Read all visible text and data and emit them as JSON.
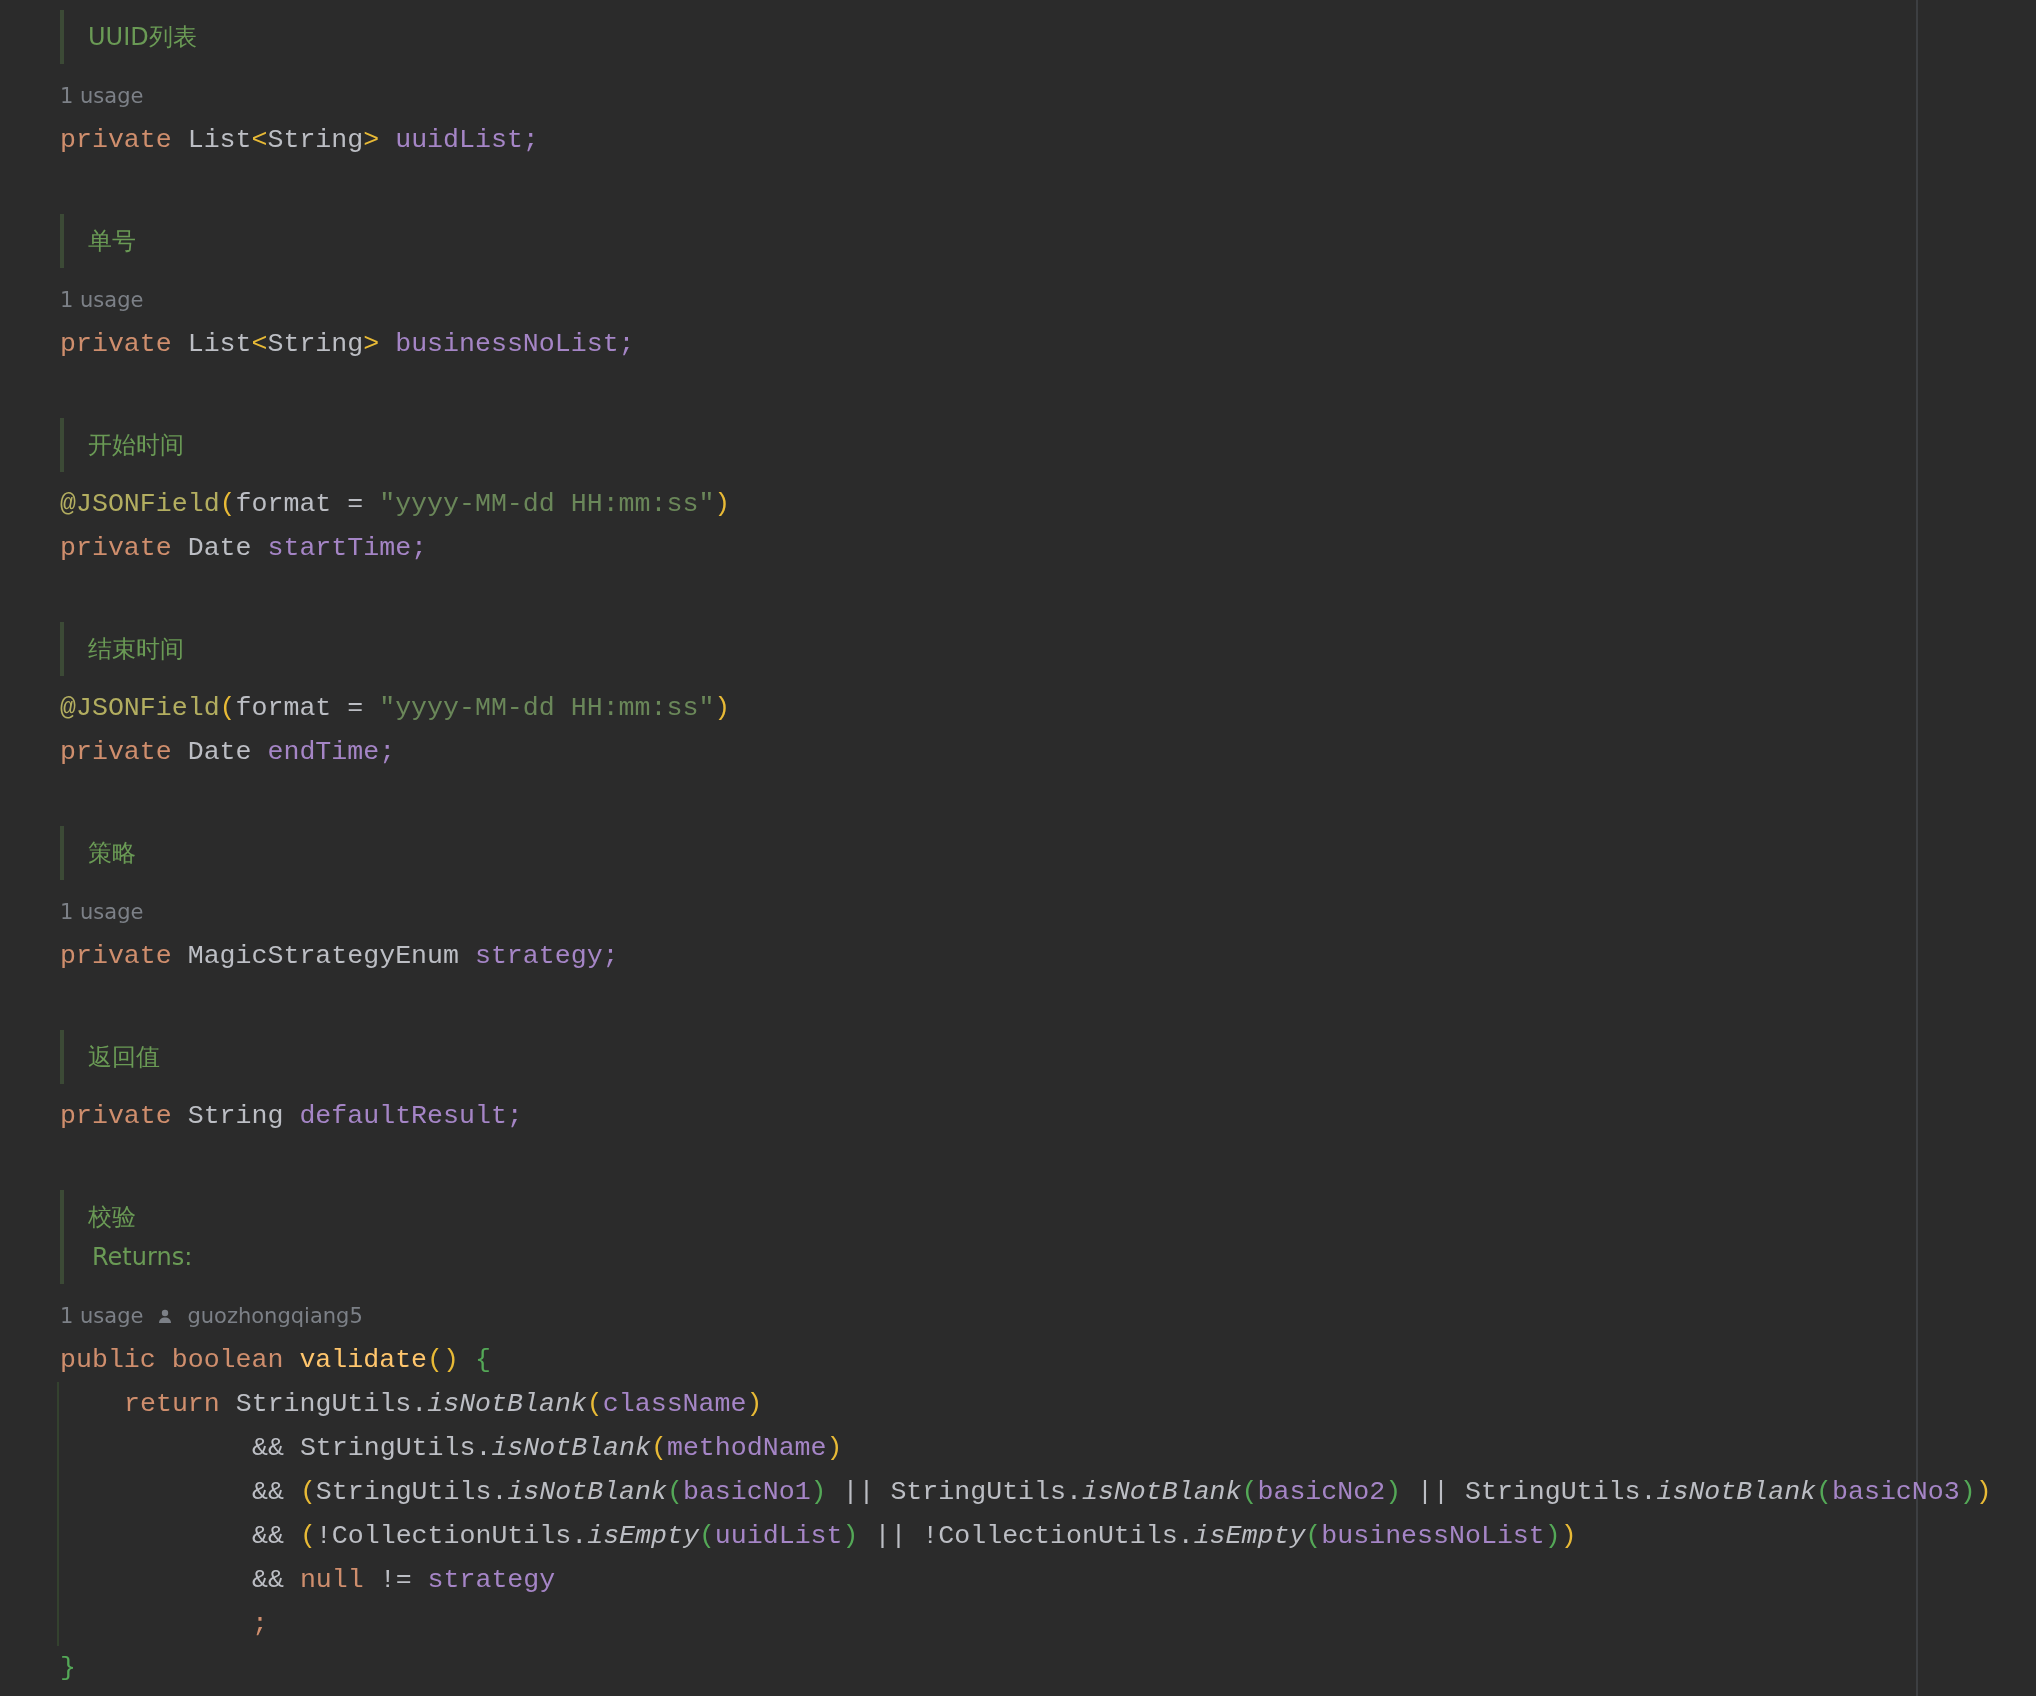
{
  "members": [
    {
      "doc": [
        {
          "text": "UUID列表",
          "kind": "summary"
        }
      ],
      "usage": "1 usage",
      "lines": [
        [
          {
            "text": "private ",
            "kind": "keyword"
          },
          {
            "text": "List",
            "kind": "plain"
          },
          {
            "text": "<",
            "kind": "bracket1"
          },
          {
            "text": "String",
            "kind": "plain"
          },
          {
            "text": ">",
            "kind": "bracket1"
          },
          {
            "text": " uuidList;",
            "kind": "field"
          }
        ]
      ]
    },
    {
      "doc": [
        {
          "text": "单号",
          "kind": "summary"
        }
      ],
      "usage": "1 usage",
      "lines": [
        [
          {
            "text": "private ",
            "kind": "keyword"
          },
          {
            "text": "List",
            "kind": "plain"
          },
          {
            "text": "<",
            "kind": "bracket1"
          },
          {
            "text": "String",
            "kind": "plain"
          },
          {
            "text": ">",
            "kind": "bracket1"
          },
          {
            "text": " businessNoList;",
            "kind": "field"
          }
        ]
      ]
    },
    {
      "doc": [
        {
          "text": "开始时间",
          "kind": "summary"
        }
      ],
      "lines": [
        [
          {
            "text": "@JSONField",
            "kind": "annotation"
          },
          {
            "text": "(",
            "kind": "bracket1"
          },
          {
            "text": "format = ",
            "kind": "plain"
          },
          {
            "text": "\"yyyy-MM-dd HH:mm:ss\"",
            "kind": "string"
          },
          {
            "text": ")",
            "kind": "bracket1"
          }
        ],
        [
          {
            "text": "private ",
            "kind": "keyword"
          },
          {
            "text": "Date ",
            "kind": "plain"
          },
          {
            "text": "startTime;",
            "kind": "field"
          }
        ]
      ]
    },
    {
      "doc": [
        {
          "text": "结束时间",
          "kind": "summary"
        }
      ],
      "lines": [
        [
          {
            "text": "@JSONField",
            "kind": "annotation"
          },
          {
            "text": "(",
            "kind": "bracket1"
          },
          {
            "text": "format = ",
            "kind": "plain"
          },
          {
            "text": "\"yyyy-MM-dd HH:mm:ss\"",
            "kind": "string"
          },
          {
            "text": ")",
            "kind": "bracket1"
          }
        ],
        [
          {
            "text": "private ",
            "kind": "keyword"
          },
          {
            "text": "Date ",
            "kind": "plain"
          },
          {
            "text": "endTime;",
            "kind": "field"
          }
        ]
      ]
    },
    {
      "doc": [
        {
          "text": "策略",
          "kind": "summary"
        }
      ],
      "usage": "1 usage",
      "lines": [
        [
          {
            "text": "private ",
            "kind": "keyword"
          },
          {
            "text": "MagicStrategyEnum ",
            "kind": "plain"
          },
          {
            "text": "strategy;",
            "kind": "field"
          }
        ]
      ]
    },
    {
      "doc": [
        {
          "text": "返回值",
          "kind": "summary"
        }
      ],
      "lines": [
        [
          {
            "text": "private ",
            "kind": "keyword"
          },
          {
            "text": "String ",
            "kind": "plain"
          },
          {
            "text": "defaultResult;",
            "kind": "field"
          }
        ]
      ]
    },
    {
      "doc": [
        {
          "text": "校验",
          "kind": "summary"
        },
        {
          "text": "Returns:",
          "kind": "tag"
        }
      ],
      "usage": "1 usage",
      "author": "guozhongqiang5",
      "lines": [
        [
          {
            "text": "public boolean ",
            "kind": "keyword"
          },
          {
            "text": "validate",
            "kind": "method"
          },
          {
            "text": "()",
            "kind": "bracket1"
          },
          {
            "text": " {",
            "kind": "bracket2"
          }
        ]
      ],
      "body": [
        {
          "kind": "statement",
          "tokens": [
            {
              "text": "return ",
              "kind": "keyword"
            },
            {
              "text": "StringUtils.",
              "kind": "plain"
            },
            {
              "text": "isNotBlank",
              "kind": "call"
            },
            {
              "text": "(",
              "kind": "bracket1"
            },
            {
              "text": "className",
              "kind": "field"
            },
            {
              "text": ")",
              "kind": "bracket1"
            }
          ]
        },
        {
          "kind": "continuation",
          "tokens": [
            {
              "text": "&& StringUtils.",
              "kind": "plain"
            },
            {
              "text": "isNotBlank",
              "kind": "call"
            },
            {
              "text": "(",
              "kind": "bracket1"
            },
            {
              "text": "methodName",
              "kind": "field"
            },
            {
              "text": ")",
              "kind": "bracket1"
            }
          ]
        },
        {
          "kind": "continuation",
          "tokens": [
            {
              "text": "&& ",
              "kind": "plain"
            },
            {
              "text": "(",
              "kind": "bracket1"
            },
            {
              "text": "StringUtils.",
              "kind": "plain"
            },
            {
              "text": "isNotBlank",
              "kind": "call"
            },
            {
              "text": "(",
              "kind": "bracket2"
            },
            {
              "text": "basicNo1",
              "kind": "field"
            },
            {
              "text": ")",
              "kind": "bracket2"
            },
            {
              "text": " || StringUtils.",
              "kind": "plain"
            },
            {
              "text": "isNotBlank",
              "kind": "call"
            },
            {
              "text": "(",
              "kind": "bracket2"
            },
            {
              "text": "basicNo2",
              "kind": "field"
            },
            {
              "text": ")",
              "kind": "bracket2"
            },
            {
              "text": " || StringUtils.",
              "kind": "plain"
            },
            {
              "text": "isNotBlank",
              "kind": "call"
            },
            {
              "text": "(",
              "kind": "bracket2"
            },
            {
              "text": "basicNo3",
              "kind": "field"
            },
            {
              "text": ")",
              "kind": "bracket2"
            },
            {
              "text": ")",
              "kind": "bracket1"
            }
          ]
        },
        {
          "kind": "continuation",
          "tokens": [
            {
              "text": "&& ",
              "kind": "plain"
            },
            {
              "text": "(",
              "kind": "bracket1"
            },
            {
              "text": "!CollectionUtils.",
              "kind": "plain"
            },
            {
              "text": "isEmpty",
              "kind": "call"
            },
            {
              "text": "(",
              "kind": "bracket2"
            },
            {
              "text": "uuidList",
              "kind": "field"
            },
            {
              "text": ")",
              "kind": "bracket2"
            },
            {
              "text": " || !CollectionUtils.",
              "kind": "plain"
            },
            {
              "text": "isEmpty",
              "kind": "call"
            },
            {
              "text": "(",
              "kind": "bracket2"
            },
            {
              "text": "businessNoList",
              "kind": "field"
            },
            {
              "text": ")",
              "kind": "bracket2"
            },
            {
              "text": ")",
              "kind": "bracket1"
            }
          ]
        },
        {
          "kind": "continuation",
          "tokens": [
            {
              "text": "&& ",
              "kind": "plain"
            },
            {
              "text": "null ",
              "kind": "keyword"
            },
            {
              "text": "!= ",
              "kind": "plain"
            },
            {
              "text": "strategy",
              "kind": "field"
            }
          ]
        },
        {
          "kind": "continuation",
          "tokens": [
            {
              "text": ";",
              "kind": "keyword"
            }
          ]
        }
      ],
      "end": [
        [
          {
            "text": "}",
            "kind": "bracket2"
          }
        ]
      ]
    }
  ]
}
